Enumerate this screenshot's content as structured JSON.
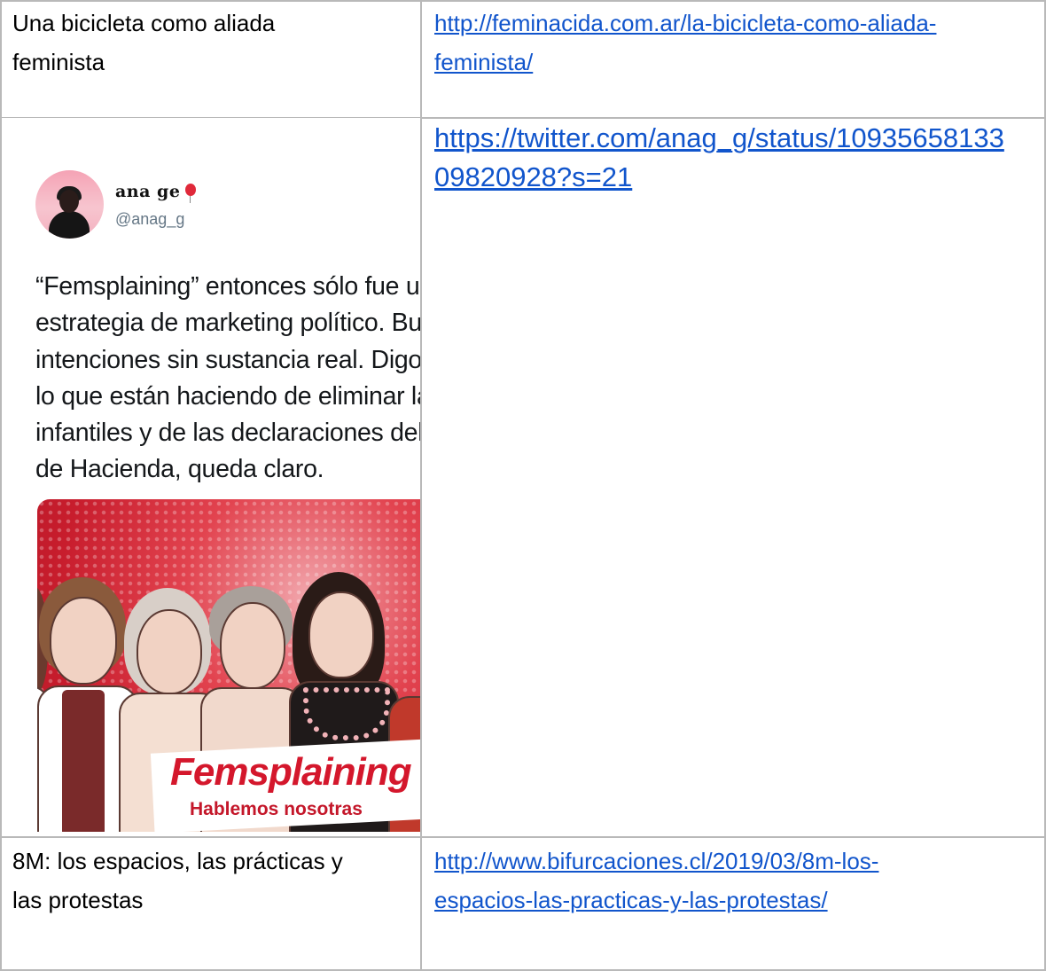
{
  "rows": [
    {
      "title": "Una bicicleta como aliada feminista",
      "title_line1": "Una bicicleta como aliada",
      "title_line2": "feminista",
      "link_line1": "http://feminacida.com.ar/la-bicicleta-como-aliada-",
      "link_line2": "feminista/"
    },
    {
      "link_line1": "https://twitter.com/anag_g/status/10935658133",
      "link_line2": "09820928?s=21",
      "tweet": {
        "name": "ana ge",
        "handle": "@anag_g",
        "text_lines": [
          "“Femsplaining” entonces sólo fue u",
          "estrategia de marketing político. Bu",
          "intenciones sin sustancia real. Digo,",
          "lo que están haciendo de eliminar la",
          "infantiles y de las declaraciones del",
          "de Hacienda, queda claro."
        ],
        "image_title": "Femsplaining",
        "image_subtitle": "Hablemos nosotras"
      }
    },
    {
      "title_line1": "8M: los espacios, las prácticas y",
      "title_line2": "las protestas",
      "link_line1": "http://www.bifurcaciones.cl/2019/03/8m-los-",
      "link_line2": "espacios-las-practicas-y-las-protestas/"
    }
  ],
  "colors": {
    "link": "#1155cc",
    "border": "#b9b9b9",
    "accent_red": "#d4172c"
  }
}
